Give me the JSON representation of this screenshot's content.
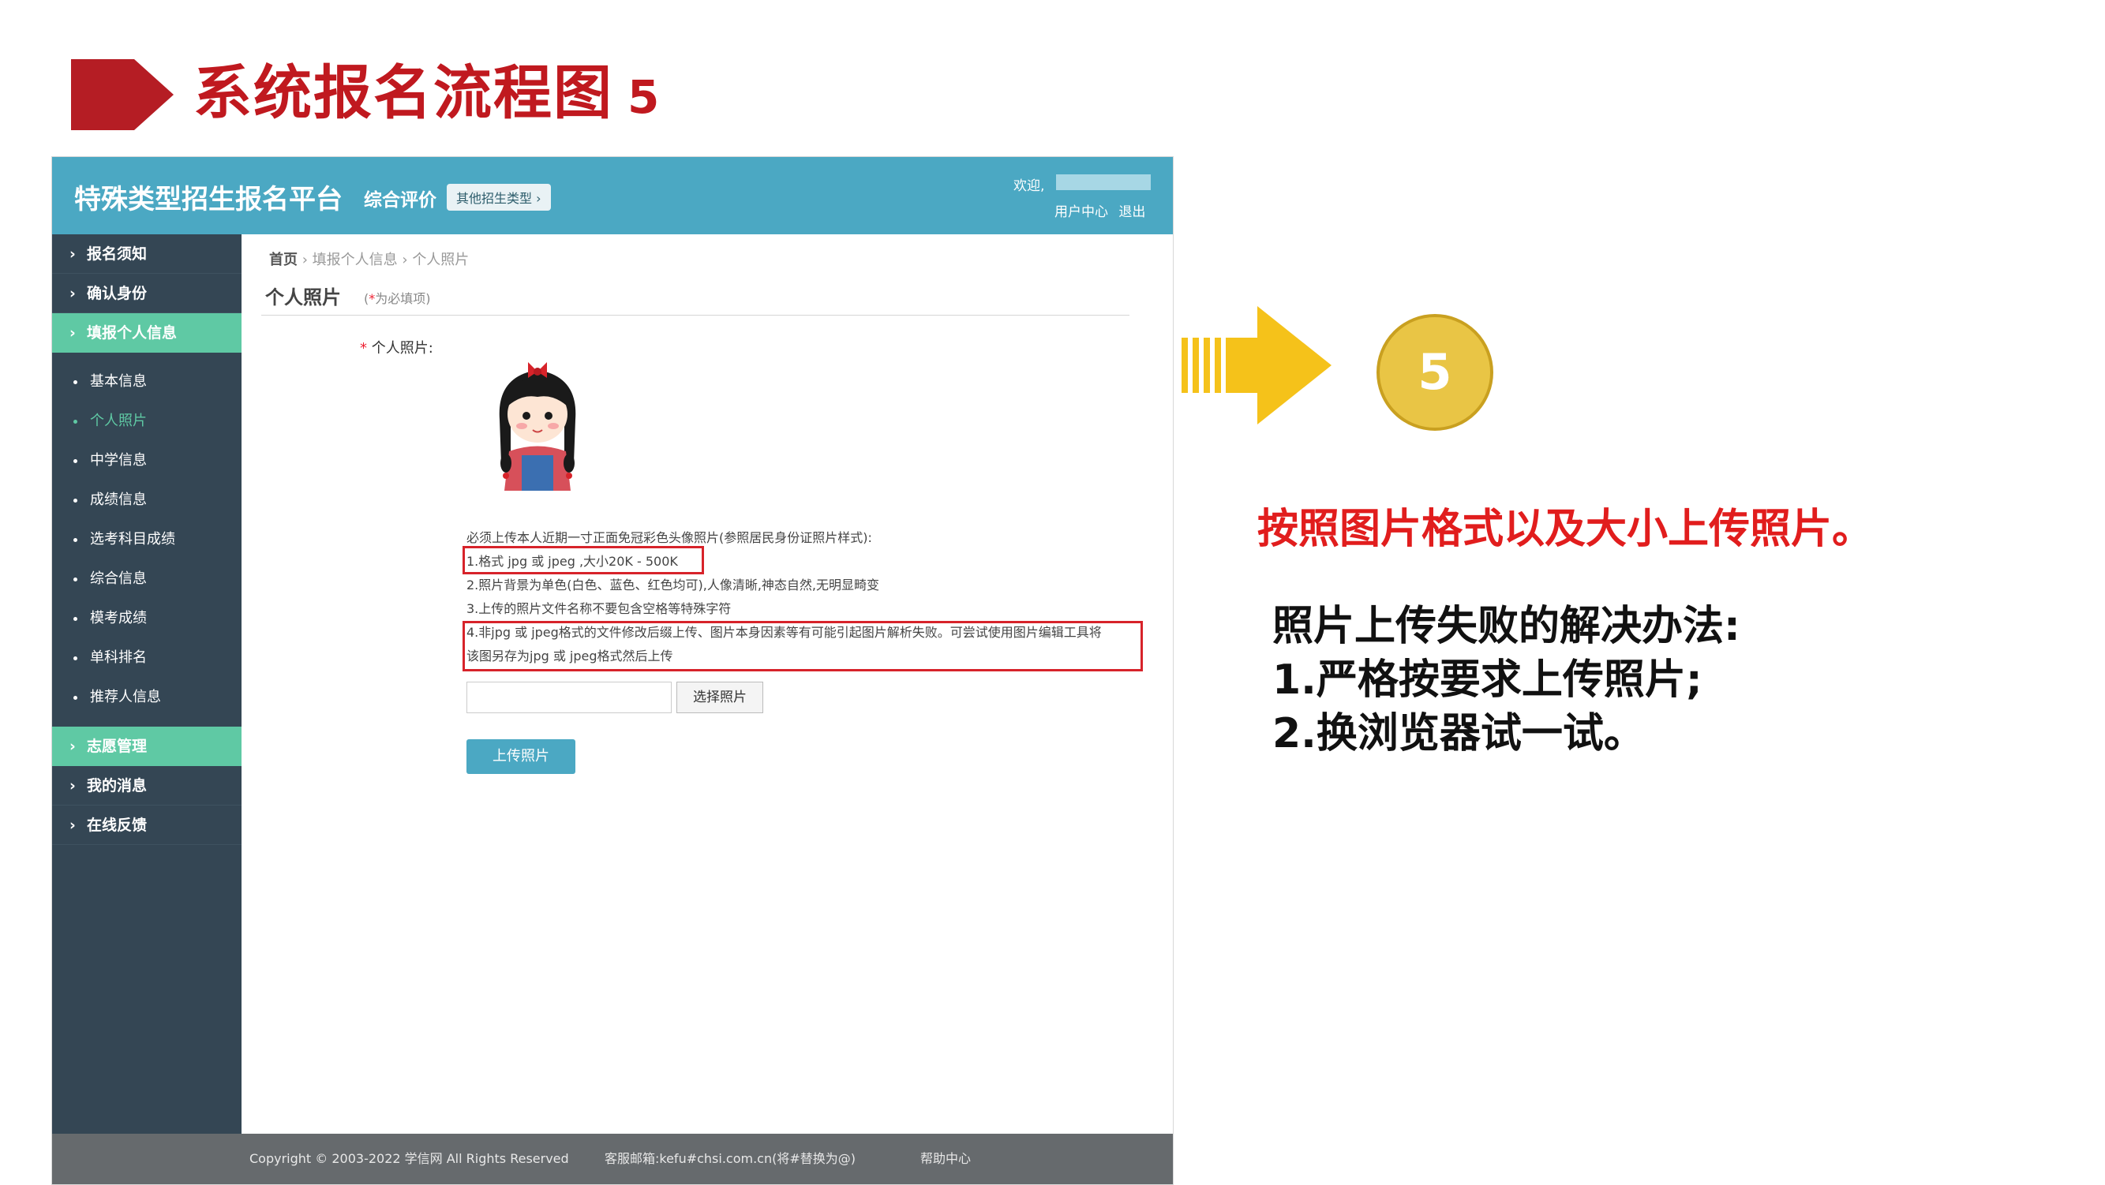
{
  "slide": {
    "title": "系统报名流程图",
    "step": "5"
  },
  "header": {
    "brand": "特殊类型招生报名平台",
    "sub": "综合评价",
    "other": "其他招生类型 ›",
    "welcome": "欢迎,",
    "links": "用户中心 退出"
  },
  "sidebar": {
    "items": [
      {
        "label": "报名须知"
      },
      {
        "label": "确认身份"
      },
      {
        "label": "填报个人信息"
      }
    ],
    "subitems": [
      {
        "label": "基本信息"
      },
      {
        "label": "个人照片"
      },
      {
        "label": "中学信息"
      },
      {
        "label": "成绩信息"
      },
      {
        "label": "选考科目成绩"
      },
      {
        "label": "综合信息"
      },
      {
        "label": "模考成绩"
      },
      {
        "label": "单科排名"
      },
      {
        "label": "推荐人信息"
      }
    ],
    "items2": [
      {
        "label": "志愿管理"
      },
      {
        "label": "我的消息"
      },
      {
        "label": "在线反馈"
      }
    ]
  },
  "content": {
    "crumb_home": "首页",
    "crumb_mid": "填报个人信息",
    "crumb_last": "个人照片",
    "title": "个人照片",
    "required_star": "*",
    "required_text": "为必填项",
    "field_label": "个人照片:",
    "instructions": [
      "必须上传本人近期一寸正面免冠彩色头像照片(参照居民身份证照片样式):",
      "1.格式 jpg 或 jpeg ,大小20K - 500K",
      "2.照片背景为单色(白色、蓝色、红色均可),人像清晰,神态自然,无明显畸变",
      "3.上传的照片文件名称不要包含空格等特殊字符",
      "4.非jpg 或 jpeg格式的文件修改后缀上传、图片本身因素等有可能引起图片解析失败。可尝试使用图片编辑工具将",
      "该图另存为jpg 或 jpeg格式然后上传"
    ],
    "choose_button": "选择照片",
    "upload_button": "上传照片"
  },
  "footer": {
    "copyright": "Copyright © 2003-2022 学信网 All Rights Reserved",
    "email": "客服邮箱:kefu#chsi.com.cn(将#替换为@)",
    "help": "帮助中心"
  },
  "annotation": {
    "step_number": "5",
    "note": "按照图片格式以及大小上传照片。",
    "solution_title": "照片上传失败的解决办法:",
    "solution_1": "1.严格按要求上传照片;",
    "solution_2": "2.换浏览器试一试。"
  },
  "colors": {
    "title_red": "#c0191f",
    "header_teal": "#4ba8c3",
    "sidebar_dark": "#344654",
    "sidebar_active": "#5fc9a4",
    "arrow_yellow": "#f5c21a",
    "note_red": "#e11d1d"
  }
}
